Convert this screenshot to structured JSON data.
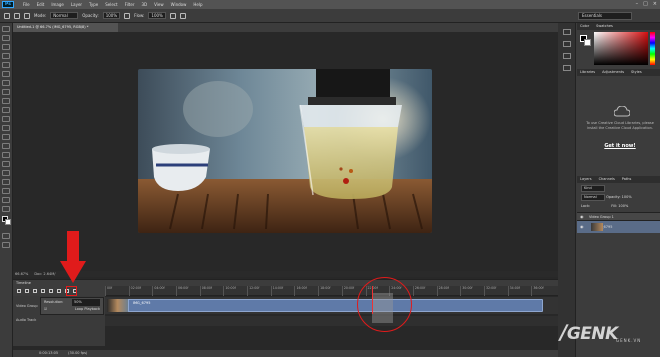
{
  "app": {
    "logo": "Ps"
  },
  "menu": [
    "File",
    "Edit",
    "Image",
    "Layer",
    "Type",
    "Select",
    "Filter",
    "3D",
    "View",
    "Window",
    "Help"
  ],
  "window_controls": [
    "–",
    "□",
    "×"
  ],
  "options_bar": {
    "mode_label": "Mode:",
    "mode_value": "Normal",
    "opacity_label": "Opacity:",
    "opacity_value": "100%",
    "flow_label": "Flow:",
    "flow_value": "100%",
    "workspace": "Essentials"
  },
  "document_tab": {
    "label": "Untitled-1 @ 66.7% (IMG_6795, RGB/8) *"
  },
  "status": {
    "zoom": "66.67%",
    "doc": "Doc: 2.64M/"
  },
  "timeline": {
    "panel_title": "Timeline",
    "ruler_ticks": [
      "00f",
      "02:00f",
      "04:00f",
      "06:00f",
      "08:00f",
      "10:00f",
      "12:00f",
      "14:00f",
      "16:00f",
      "18:00f",
      "20:00f",
      "22:00f",
      "24:00f",
      "26:00f",
      "28:00f",
      "30:00f",
      "32:00f",
      "34:00f",
      "36:00f"
    ],
    "video_group_label": "Video Group",
    "clip_label": "IMG_6795",
    "audio_track_label": "Audio Track",
    "settings": {
      "resolution_label": "Resolution:",
      "resolution_value": "50%",
      "loop_label": "Loop Playback"
    },
    "footer": {
      "time": "0:00:13:05",
      "fps": "(30.00 fps)"
    }
  },
  "right_panel": {
    "swatch_tabs": [
      "Color",
      "Swatches"
    ],
    "library_tabs": [
      "Libraries",
      "Adjustments",
      "Styles"
    ],
    "cc_message": "To use Creative Cloud Libraries, please install the Creative Cloud Application.",
    "cc_link": "Get it now!",
    "layers_tabs": [
      "Layers",
      "Channels",
      "Paths"
    ],
    "layers_kind": "Kind",
    "layers_blend": "Normal",
    "layers_opacity_label": "Opacity:",
    "layers_opacity": "100%",
    "layers_lock_label": "Lock:",
    "layers_fill_label": "Fill:",
    "layers_fill": "100%",
    "layer_group": "Video Group 1",
    "layer_clip": "IMG_6795"
  },
  "watermark": {
    "brand": "GENK",
    "sub": "GENK.VN"
  },
  "colors": {
    "accent": "#31a8ff",
    "clip": "#5f7aa8",
    "annotation": "#e01b1b"
  }
}
